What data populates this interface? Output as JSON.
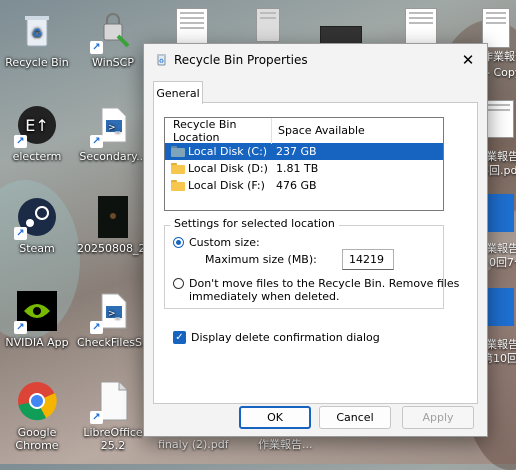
{
  "desktop": {
    "icons": [
      {
        "label": "Recycle Bin",
        "icon": "recycle-bin-icon"
      },
      {
        "label": "WinSCP",
        "icon": "winscp-icon"
      },
      {
        "label": "electerm",
        "icon": "electerm-icon"
      },
      {
        "label": "Secondary...",
        "icon": "powershell-script-icon"
      },
      {
        "label": "Steam",
        "icon": "steam-icon"
      },
      {
        "label": "20250808_2...",
        "icon": "image-file-icon"
      },
      {
        "label": "NVIDIA App",
        "icon": "nvidia-icon"
      },
      {
        "label": "CheckFilesS...",
        "icon": "powershell-script-icon"
      },
      {
        "label": "Google Chrome",
        "icon": "chrome-icon"
      },
      {
        "label": "LibreOffice 25.2",
        "icon": "libreoffice-icon"
      }
    ],
    "right_labels": [
      "作業報告書",
      "- Copy",
      "業報告書",
      "6回.pdf",
      "業報告書",
      "10回7セ",
      "業報告書",
      "第10回7セ"
    ],
    "bottom_labels": [
      "finaly (2).pdf",
      "作業報告..."
    ]
  },
  "dialog": {
    "title": "Recycle Bin Properties",
    "tab": "General",
    "list": {
      "headers": [
        "Recycle Bin Location",
        "Space Available"
      ],
      "rows": [
        {
          "location": "Local Disk (C:)",
          "space": "237 GB",
          "selected": true
        },
        {
          "location": "Local Disk (D:)",
          "space": "1.81 TB",
          "selected": false
        },
        {
          "location": "Local Disk (F:)",
          "space": "476 GB",
          "selected": false
        }
      ]
    },
    "settings": {
      "legend": "Settings for selected location",
      "custom_size_label": "Custom size:",
      "max_size_label": "Maximum size (MB):",
      "max_size_value": "14219",
      "dont_move_line1": "Don't move files to the Recycle Bin. Remove files",
      "dont_move_line2": "immediately when deleted."
    },
    "confirm_label": "Display delete confirmation dialog",
    "buttons": {
      "ok": "OK",
      "cancel": "Cancel",
      "apply": "Apply"
    },
    "colors": {
      "accent": "#1664c0",
      "selected_row": "#1664c0"
    }
  }
}
